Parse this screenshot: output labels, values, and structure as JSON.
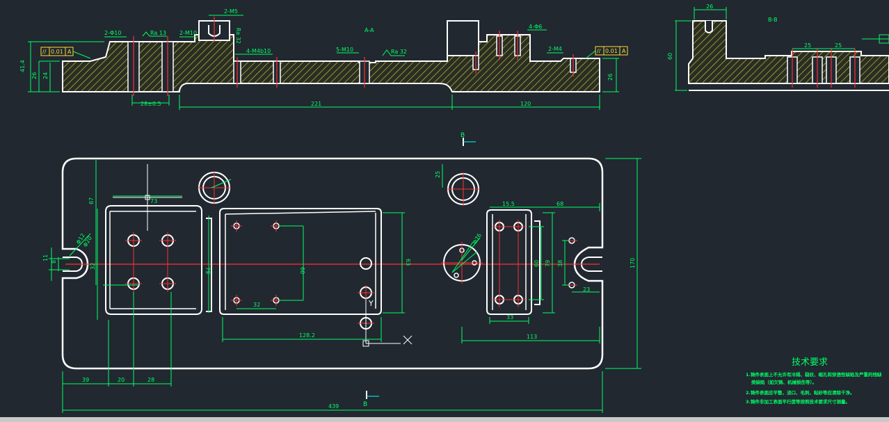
{
  "section_labels": {
    "a": "A-A",
    "b": "B-B"
  },
  "view_markers": {
    "top": "B",
    "bottom": "B"
  },
  "colors": {
    "background": "#212830",
    "outline": "#ffffff",
    "dimension": "#00ff66",
    "centerline": "#ff3030",
    "hatch": "#c9c94a",
    "notes": "#00ff66"
  },
  "section_aa": {
    "callouts": [
      "2-M5",
      "2-Φ10",
      "2-M10",
      "4-M4b10",
      "5-M10",
      "4-Φ6",
      "2-M4"
    ],
    "roughness": [
      "Ra 13",
      "Ra 32",
      "Ra 32"
    ],
    "tolerance_left": [
      "//",
      "0.01",
      "A"
    ],
    "tolerance_right": [
      "//",
      "0.01",
      "A"
    ],
    "dims": {
      "h_overall": "41.4",
      "h_total": "26",
      "h_inner": "24",
      "w_bore": "28±0.5",
      "w_mid": "221",
      "w_right": "120",
      "h_right": "26"
    }
  },
  "section_bb": {
    "dims": {
      "w_top": "26",
      "h_left": "60",
      "spacing_1": "25",
      "spacing_2": "25"
    }
  },
  "plan": {
    "dims": {
      "d67": "67",
      "d73": "73",
      "d25": "25",
      "d15_5": "15.5",
      "d68": "68",
      "d11": "11",
      "d8": "8",
      "d12": "Φ12",
      "d20r": "Φ20",
      "d32l": "32",
      "d79l": "79",
      "d60m": "60",
      "d32m": "32",
      "d63": "63",
      "d60r": "60",
      "d79r": "79",
      "d38": "38",
      "d23": "23",
      "d170": "170",
      "d33": "33",
      "d128": "128.2",
      "d113": "113",
      "d39": "39",
      "d20": "20",
      "d28": "28",
      "d439": "439",
      "phi76": "Φ76"
    },
    "ucs": {
      "x": "X",
      "y": "Y"
    }
  },
  "notes": {
    "title": "技术要求",
    "items": [
      "1.铸件表面上不允许有冷隔、裂纹、缩孔和穿透性缺陷及严重的残缺类缺陷（如欠铸、机械损伤等）。",
      "2.铸件表面应平整，浇口、毛刺、粘砂等应清除干净。",
      "3.铸件非加工表面平行度等按照技术要求尺寸测量。"
    ]
  }
}
